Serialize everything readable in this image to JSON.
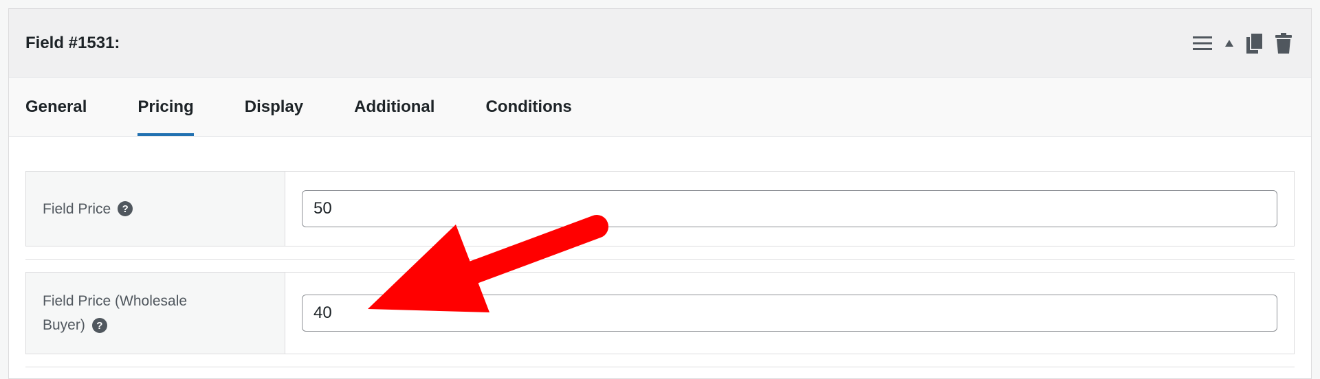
{
  "header": {
    "title": "Field #1531:",
    "icons": [
      "menu-icon",
      "collapse-triangle-icon",
      "duplicate-icon",
      "trash-icon"
    ]
  },
  "tabs": [
    {
      "label": "General",
      "active": false
    },
    {
      "label": "Pricing",
      "active": true
    },
    {
      "label": "Display",
      "active": false
    },
    {
      "label": "Additional",
      "active": false
    },
    {
      "label": "Conditions",
      "active": false
    }
  ],
  "fields": [
    {
      "label": "Field Price",
      "value": "50"
    },
    {
      "label_line1": "Field Price (Wholesale",
      "label_line2": "Buyer)",
      "value": "40"
    }
  ],
  "help_glyph": "?",
  "colors": {
    "accent": "#2271b1",
    "arrow": "#ff0000"
  }
}
